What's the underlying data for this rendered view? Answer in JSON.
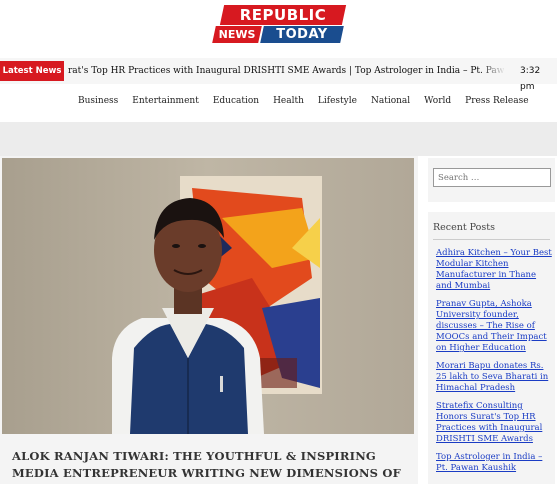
{
  "logo": {
    "line1": "REPUBLIC",
    "news": "NEWS",
    "today": "TODAY",
    "colors": {
      "red": "#d71920",
      "blue": "#1a4d8f"
    }
  },
  "ticker": {
    "label": "Latest News",
    "text": "rat's Top HR Practices with Inaugural DRISHTI SME Awards  |  Top Astrologer in India – Pt. Pawan Kaushik  |  Th",
    "time": "3:32 pm"
  },
  "nav": {
    "items": [
      "Business",
      "Entertainment",
      "Education",
      "Health",
      "Lifestyle",
      "National",
      "World",
      "Press Release"
    ]
  },
  "article": {
    "headline": "ALOK RANJAN TIWARI: THE YOUTHFUL & INSPIRING MEDIA ENTREPRENEUR WRITING NEW DIMENSIONS OF SUCCESS"
  },
  "sidebar": {
    "search_placeholder": "Search …",
    "recent_title": "Recent Posts",
    "recent_posts": [
      "Adhira Kitchen – Your Best Modular Kitchen Manufacturer in Thane and Mumbai",
      "Pranav Gupta, Ashoka University founder, discusses – The Rise of MOOCs and Their Impact on Higher Education",
      "Morari Bapu donates Rs. 25 lakh to Seva Bharati in Himachal Pradesh",
      "Stratefix Consulting Honors Surat's Top HR Practices with Inaugural DRISHTI SME Awards",
      "Top Astrologer in India – Pt. Pawan Kaushik"
    ]
  }
}
